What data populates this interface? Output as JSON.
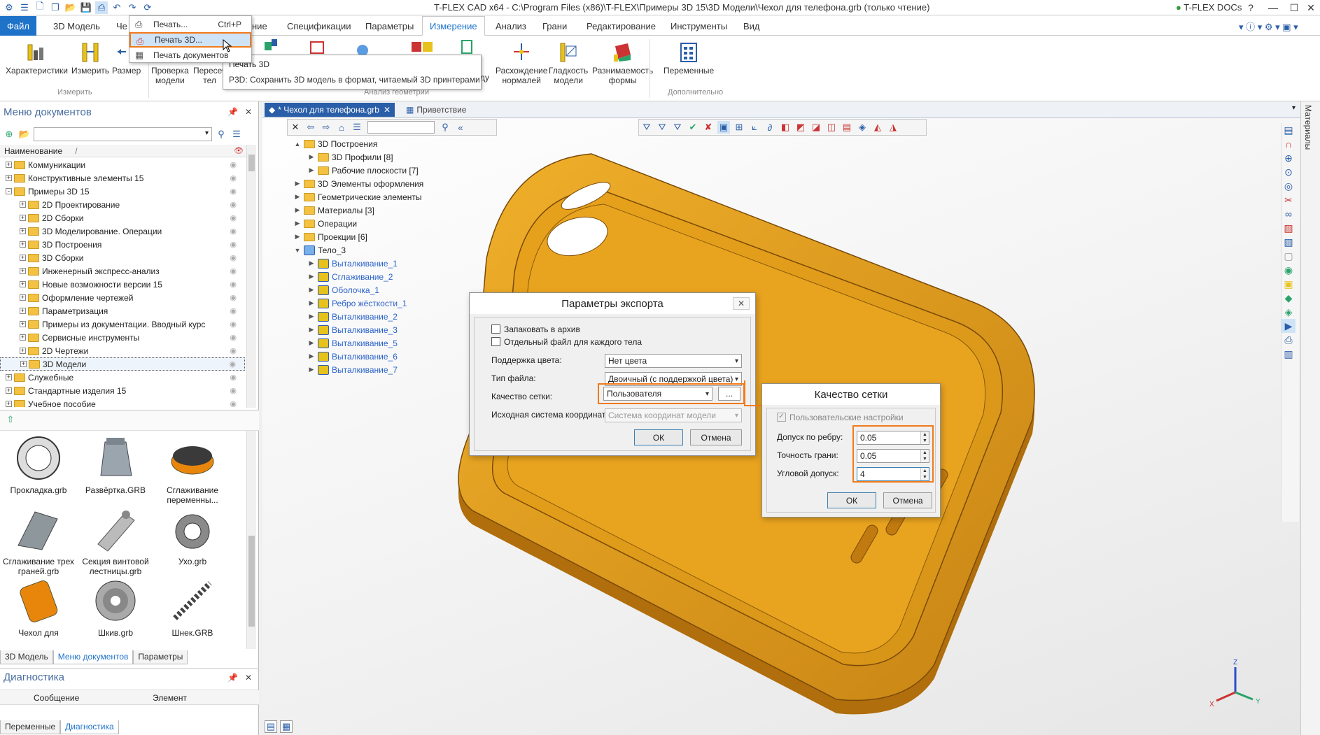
{
  "window": {
    "title": "T-FLEX CAD x64 - C:\\Program Files (x86)\\T-FLEX\\Примеры 3D 15\\3D Модели\\Чехол для телефона.grb (только чтение)",
    "docs_button": "T-FLEX DOCs",
    "min_icon": "minimize-icon",
    "max_icon": "maximize-icon",
    "close_icon": "close-icon"
  },
  "menu_tabs": [
    "Файл",
    "3D Модель",
    "Че",
    "ние",
    "Спецификации",
    "Параметры",
    "Измерение",
    "Анализ",
    "Грани",
    "Редактирование",
    "Инструменты",
    "Вид"
  ],
  "ribbon": {
    "buttons": [
      {
        "label": "Характеристики",
        "label2": ""
      },
      {
        "label": "Измерить",
        "label2": ""
      },
      {
        "label": "Размер",
        "label2": ""
      },
      {
        "label": "Проверка",
        "label2": "модели"
      },
      {
        "label": "Пересеч",
        "label2": "тел"
      },
      {
        "label": "Расхождение",
        "label2": "нормалей"
      },
      {
        "label": "Гладкость",
        "label2": "модели"
      },
      {
        "label": "Разнимаемость",
        "label2": "формы"
      },
      {
        "label": "Переменные",
        "label2": ""
      }
    ],
    "groups": {
      "measure": "Измерить",
      "analysis": "Анализ геометрии",
      "extra": "Дополнительно"
    },
    "partial_label": "ду"
  },
  "print_menu": {
    "items": [
      {
        "label": "Печать...",
        "shortcut": "Ctrl+P"
      },
      {
        "label": "Печать 3D...",
        "shortcut": ""
      },
      {
        "label": "Печать документов",
        "shortcut": ""
      }
    ]
  },
  "tooltip": {
    "title": "Печать 3D",
    "desc": "P3D: Сохранить 3D модель в формат, читаемый 3D принтерами"
  },
  "doc_menu": {
    "title": "Меню документов",
    "col_name": "Наименование",
    "tree": [
      {
        "label": "Коммуникации",
        "level": 0,
        "exp": "+"
      },
      {
        "label": "Конструктивные элементы 15",
        "level": 0,
        "exp": "+"
      },
      {
        "label": "Примеры 3D 15",
        "level": 0,
        "exp": "-"
      },
      {
        "label": "2D Проектирование",
        "level": 1,
        "exp": "+"
      },
      {
        "label": "2D Сборки",
        "level": 1,
        "exp": "+"
      },
      {
        "label": "3D Моделирование. Операции",
        "level": 1,
        "exp": "+"
      },
      {
        "label": "3D Построения",
        "level": 1,
        "exp": "+"
      },
      {
        "label": "3D Сборки",
        "level": 1,
        "exp": "+"
      },
      {
        "label": "Инженерный экспресс-анализ",
        "level": 1,
        "exp": "+"
      },
      {
        "label": "Новые возможности версии 15",
        "level": 1,
        "exp": "+"
      },
      {
        "label": "Оформление чертежей",
        "level": 1,
        "exp": "+"
      },
      {
        "label": "Параметризация",
        "level": 1,
        "exp": "+"
      },
      {
        "label": "Примеры из документации. Вводный курс",
        "level": 1,
        "exp": "+"
      },
      {
        "label": "Сервисные инструменты",
        "level": 1,
        "exp": "+"
      },
      {
        "label": "2D Чертежи",
        "level": 1,
        "exp": "+"
      },
      {
        "label": "3D Модели",
        "level": 1,
        "exp": "+"
      },
      {
        "label": "Служебные",
        "level": 0,
        "exp": "+"
      },
      {
        "label": "Стандартные изделия 15",
        "level": 0,
        "exp": "+"
      },
      {
        "label": "Учебное пособие",
        "level": 0,
        "exp": "+"
      }
    ],
    "thumbs": [
      {
        "l1": "Прокладка.grb",
        "l2": ""
      },
      {
        "l1": "Развёртка.GRB",
        "l2": ""
      },
      {
        "l1": "Сглаживание",
        "l2": "переменны..."
      },
      {
        "l1": "Сглаживание трех",
        "l2": "граней.grb"
      },
      {
        "l1": "Секция винтовой",
        "l2": "лестницы.grb"
      },
      {
        "l1": "Ухо.grb",
        "l2": ""
      },
      {
        "l1": "Чехол для",
        "l2": ""
      },
      {
        "l1": "Шкив.grb",
        "l2": ""
      },
      {
        "l1": "Шнек.GRB",
        "l2": ""
      }
    ],
    "bottom_tabs": [
      "3D Модель",
      "Меню документов",
      "Параметры"
    ]
  },
  "diagnostics": {
    "title": "Диагностика",
    "col_msg": "Сообщение",
    "col_el": "Элемент",
    "tabs": [
      "Переменные",
      "Диагностика"
    ]
  },
  "doc_tabs": {
    "active": "* Чехол для телефона.grb",
    "other": "Приветствие"
  },
  "right_strip_label": "Материалы",
  "model_tree": [
    {
      "label": "3D Построения",
      "indent": 0,
      "exp": "▲",
      "type": "folder",
      "blue": false
    },
    {
      "label": "3D Профили [8]",
      "indent": 1,
      "exp": "▶",
      "type": "folder",
      "blue": false
    },
    {
      "label": "Рабочие плоскости [7]",
      "indent": 1,
      "exp": "▶",
      "type": "folder",
      "blue": false
    },
    {
      "label": "3D Элементы оформления",
      "indent": 0,
      "exp": "▶",
      "type": "folder",
      "blue": false
    },
    {
      "label": "Геометрические элементы",
      "indent": 0,
      "exp": "▶",
      "type": "folder",
      "blue": false
    },
    {
      "label": "Материалы [3]",
      "indent": 0,
      "exp": "▶",
      "type": "folder",
      "blue": false
    },
    {
      "label": "Операции",
      "indent": 0,
      "exp": "▶",
      "type": "folder",
      "blue": false
    },
    {
      "label": "Проекции [6]",
      "indent": 0,
      "exp": "▶",
      "type": "folder",
      "blue": false
    },
    {
      "label": "Тело_3",
      "indent": 0,
      "exp": "▼",
      "type": "body",
      "blue": false
    },
    {
      "label": "Выталкивание_1",
      "indent": 1,
      "exp": "▶",
      "type": "op",
      "blue": true
    },
    {
      "label": "Сглаживание_2",
      "indent": 1,
      "exp": "▶",
      "type": "op",
      "blue": true
    },
    {
      "label": "Оболочка_1",
      "indent": 1,
      "exp": "▶",
      "type": "op",
      "blue": true
    },
    {
      "label": "Ребро жёсткости_1",
      "indent": 1,
      "exp": "▶",
      "type": "op",
      "blue": true
    },
    {
      "label": "Выталкивание_2",
      "indent": 1,
      "exp": "▶",
      "type": "op",
      "blue": true
    },
    {
      "label": "Выталкивание_3",
      "indent": 1,
      "exp": "▶",
      "type": "op",
      "blue": true
    },
    {
      "label": "Выталкивание_5",
      "indent": 1,
      "exp": "▶",
      "type": "op",
      "blue": true
    },
    {
      "label": "Выталкивание_6",
      "indent": 1,
      "exp": "▶",
      "type": "op",
      "blue": true
    },
    {
      "label": "Выталкивание_7",
      "indent": 1,
      "exp": "▶",
      "type": "op",
      "blue": true
    }
  ],
  "export_dialog": {
    "title": "Параметры экспорта",
    "archive": "Запаковать в архив",
    "separate": "Отдельный файл для каждого тела",
    "color_label": "Поддержка цвета:",
    "color_value": "Нет цвета",
    "filetype_label": "Тип файла:",
    "filetype_value": "Двоичный (с поддержкой цвета)",
    "mesh_label": "Качество сетки:",
    "mesh_value": "Пользователя",
    "coord_label": "Исходная система координат:",
    "coord_value": "Система координат модели",
    "ok": "ОК",
    "cancel": "Отмена",
    "ellipsis": "..."
  },
  "mesh_dialog": {
    "title": "Качество сетки",
    "user_settings": "Пользовательские настройки",
    "edge_tol_label": "Допуск по ребру:",
    "edge_tol": "0.05",
    "face_acc_label": "Точность грани:",
    "face_acc": "0.05",
    "angle_tol_label": "Угловой допуск:",
    "angle_tol": "4",
    "ok": "ОК",
    "cancel": "Отмена"
  },
  "axes": {
    "x": "X",
    "y": "Y",
    "z": "Z"
  },
  "colors": {
    "accent": "#1e73c9",
    "highlight": "#f27a1a",
    "model": "#e8a21c"
  }
}
